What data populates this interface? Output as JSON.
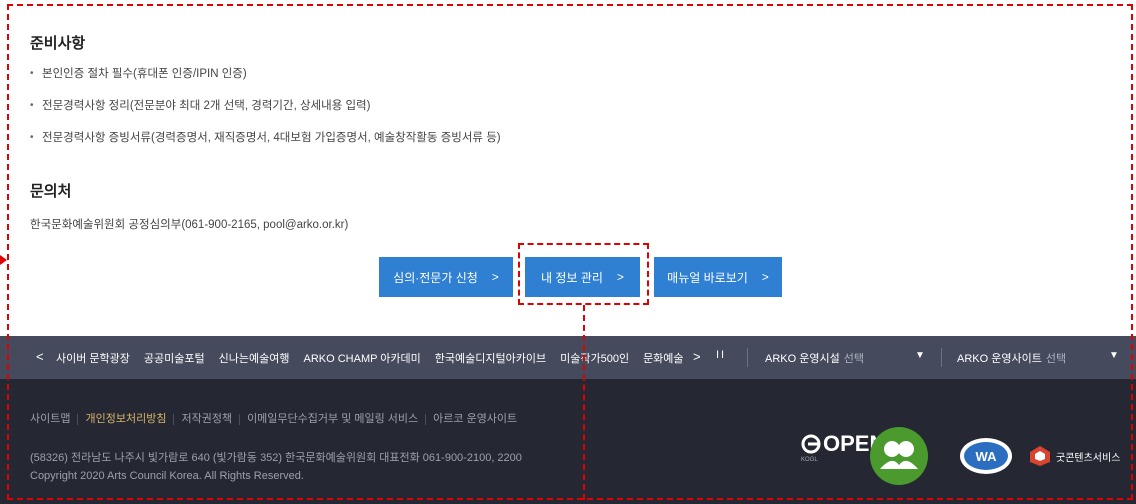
{
  "preparation": {
    "title": "준비사항",
    "items": [
      "본인인증 절차 필수(휴대폰 인증/IPIN 인증)",
      "전문경력사항 정리(전문분야 최대 2개 선택, 경력기간, 상세내용 입력)",
      "전문경력사항 증빙서류(경력증명서, 재직증명서, 4대보험 가입증명서, 예술창작활동 증빙서류 등)"
    ]
  },
  "contact": {
    "title": "문의처",
    "text": "한국문화예술위원회 공정심의부(061-900-2165, pool@arko.or.kr)"
  },
  "buttons": {
    "apply": "심의·전문가 신청",
    "my_info": "내 정보 관리",
    "manual": "매뉴얼 바로보기",
    "chevron": ">"
  },
  "link_bar": {
    "prev": "<",
    "next": ">",
    "pause": "II",
    "links": [
      "사이버 문학광장",
      "공공미술포털",
      "신나는예술여행",
      "ARKO CHAMP 아카데미",
      "한국예술디지털아카이브",
      "미술작가500인",
      "문화예술"
    ],
    "facilities_label": "ARKO 운영시설",
    "facilities_suffix": "선택",
    "sites_label": "ARKO 운영사이트",
    "sites_suffix": "선택"
  },
  "footer": {
    "links": [
      "사이트맵",
      "개인정보처리방침",
      "저작권정책",
      "이메일무단수집거부 및 메일링 서비스",
      "아르코 운영사이트"
    ],
    "address": "(58326) 전라남도 나주시 빛가람로 640 (빛가람동 352) 한국문화예술위원회 대표전화 061-900-2100, 2200",
    "copyright": "Copyright 2020 Arts Council Korea. All Rights Reserved.",
    "logos": {
      "open": "OPEN",
      "open_sub": "KOGL",
      "eprivacy": "ePRIVACY PLUS",
      "wa": "WA",
      "gov_service": "굿콘텐츠서비스"
    }
  },
  "colors": {
    "button": "#2f7fd3",
    "link_bar": "#454b5c",
    "footer": "#252833",
    "highlight": "#e00000",
    "privacy_link": "#d9b46a"
  }
}
